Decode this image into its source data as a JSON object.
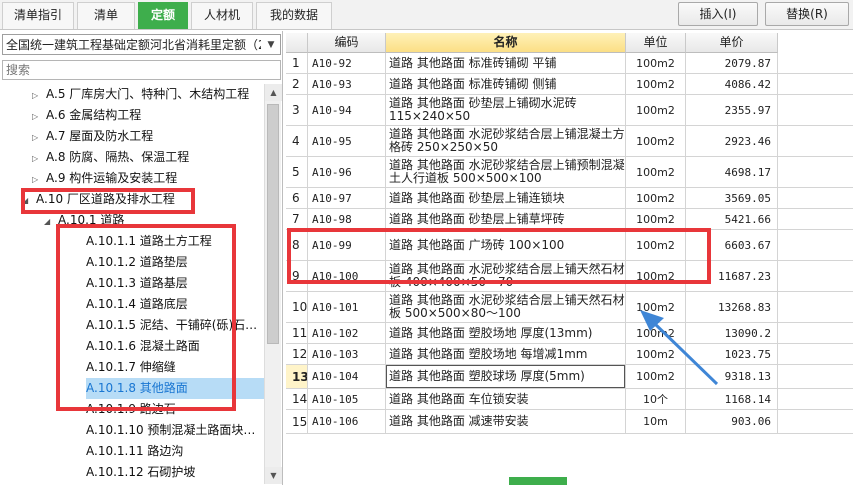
{
  "tabs": [
    {
      "label": "清单指引",
      "active": false
    },
    {
      "label": "清单",
      "active": false
    },
    {
      "label": "定额",
      "active": true
    },
    {
      "label": "人材机",
      "active": false
    },
    {
      "label": "我的数据",
      "active": false
    }
  ],
  "actions": {
    "insert_label": "插入(I)",
    "replace_label": "替换(R)"
  },
  "left": {
    "quota_select_value": "全国统一建筑工程基础定额河北省消耗里定额（2",
    "search_placeholder": "搜索"
  },
  "tree": [
    {
      "label": "A.5 厂库房大门、特种门、木结构工程",
      "level": 1,
      "arrow": "▷",
      "selected": false
    },
    {
      "label": "A.6 金属结构工程",
      "level": 1,
      "arrow": "▷",
      "selected": false
    },
    {
      "label": "A.7 屋面及防水工程",
      "level": 1,
      "arrow": "▷",
      "selected": false
    },
    {
      "label": "A.8 防腐、隔热、保温工程",
      "level": 1,
      "arrow": "▷",
      "selected": false
    },
    {
      "label": "A.9 构件运输及安装工程",
      "level": 1,
      "arrow": "▷",
      "selected": false
    },
    {
      "label": "A.10 厂区道路及排水工程",
      "level": 0,
      "arrow": "◢",
      "selected": false
    },
    {
      "label": "A.10.1 道路",
      "level": 2,
      "arrow": "◢",
      "selected": false
    },
    {
      "label": "A.10.1.1 道路土方工程",
      "level": 3,
      "arrow": "",
      "selected": false
    },
    {
      "label": "A.10.1.2 道路垫层",
      "level": 3,
      "arrow": "",
      "selected": false
    },
    {
      "label": "A.10.1.3 道路基层",
      "level": 3,
      "arrow": "",
      "selected": false
    },
    {
      "label": "A.10.1.4 道路底层",
      "level": 3,
      "arrow": "",
      "selected": false
    },
    {
      "label": "A.10.1.5 泥结、干铺碎(砾)石…",
      "level": 3,
      "arrow": "",
      "selected": false
    },
    {
      "label": "A.10.1.6 混凝土路面",
      "level": 3,
      "arrow": "",
      "selected": false
    },
    {
      "label": "A.10.1.7 伸缩缝",
      "level": 3,
      "arrow": "",
      "selected": false
    },
    {
      "label": "A.10.1.8 其他路面",
      "level": 3,
      "arrow": "",
      "selected": true
    },
    {
      "label": "A.10.1.9 路边石",
      "level": 3,
      "arrow": "",
      "selected": false
    },
    {
      "label": "A.10.1.10 预制混凝土路面块…",
      "level": 3,
      "arrow": "",
      "selected": false
    },
    {
      "label": "A.10.1.11 路边沟",
      "level": 3,
      "arrow": "",
      "selected": false
    },
    {
      "label": "A.10.1.12 石砌护坡",
      "level": 3,
      "arrow": "",
      "selected": false
    }
  ],
  "grid": {
    "columns": [
      "",
      "编码",
      "名称",
      "单位",
      "单价"
    ],
    "rows": [
      {
        "idx": "1",
        "code": "A10-92",
        "name": "道路 其他路面 标准砖铺砌 平铺",
        "unit": "100m2",
        "price": "2079.87"
      },
      {
        "idx": "2",
        "code": "A10-93",
        "name": "道路 其他路面 标准砖铺砌 侧铺",
        "unit": "100m2",
        "price": "4086.42"
      },
      {
        "idx": "3",
        "code": "A10-94",
        "name": "道路 其他路面 砂垫层上铺砌水泥砖 115×240×50",
        "unit": "100m2",
        "price": "2355.97"
      },
      {
        "idx": "4",
        "code": "A10-95",
        "name": "道路 其他路面 水泥砂浆结合层上铺混凝土方格砖 250×250×50",
        "unit": "100m2",
        "price": "2923.46"
      },
      {
        "idx": "5",
        "code": "A10-96",
        "name": "道路 其他路面 水泥砂浆结合层上铺预制混凝土人行道板 500×500×100",
        "unit": "100m2",
        "price": "4698.17"
      },
      {
        "idx": "6",
        "code": "A10-97",
        "name": "道路 其他路面 砂垫层上铺连锁块",
        "unit": "100m2",
        "price": "3569.05"
      },
      {
        "idx": "7",
        "code": "A10-98",
        "name": "道路 其他路面 砂垫层上铺草坪砖",
        "unit": "100m2",
        "price": "5421.66"
      },
      {
        "idx": "8",
        "code": "A10-99",
        "name": "道路 其他路面 广场砖 100×100",
        "unit": "100m2",
        "price": "6603.67"
      },
      {
        "idx": "9",
        "code": "A10-100",
        "name": "道路 其他路面 水泥砂浆结合层上铺天然石材板 400×400×50～70",
        "unit": "100m2",
        "price": "11687.23"
      },
      {
        "idx": "10",
        "code": "A10-101",
        "name": "道路 其他路面 水泥砂浆结合层上铺天然石材板 500×500×80～100",
        "unit": "100m2",
        "price": "13268.83"
      },
      {
        "idx": "11",
        "code": "A10-102",
        "name": "道路 其他路面 塑胶场地 厚度(13mm)",
        "unit": "100m2",
        "price": "13090.2"
      },
      {
        "idx": "12",
        "code": "A10-103",
        "name": "道路 其他路面 塑胶场地 每增减1mm",
        "unit": "100m2",
        "price": "1023.75"
      },
      {
        "idx": "13",
        "code": "A10-104",
        "name": "道路 其他路面 塑胶球场 厚度(5mm)",
        "unit": "100m2",
        "price": "9318.13"
      },
      {
        "idx": "14",
        "code": "A10-105",
        "name": "道路 其他路面 车位锁安装",
        "unit": "10个",
        "price": "1168.14"
      },
      {
        "idx": "15",
        "code": "A10-106",
        "name": "道路 其他路面 减速带安装",
        "unit": "10m",
        "price": "903.06"
      }
    ]
  },
  "colors": {
    "accent_green": "#3eae4c",
    "highlight_red": "#e8363a",
    "arrow_blue": "#3f86d6",
    "selection_blue": "#b7dcf6"
  }
}
